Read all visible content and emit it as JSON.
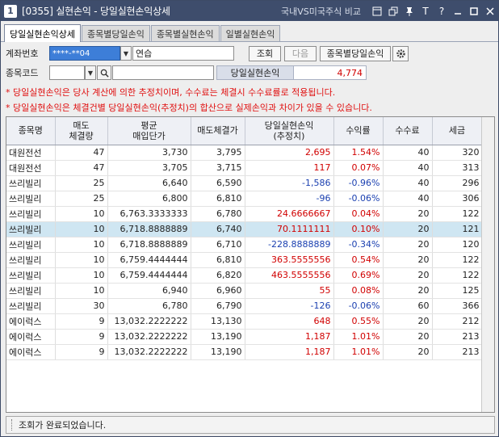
{
  "titlebar": {
    "badge": "1",
    "title": "[0355] 실현손익 - 당일실현손익상세",
    "compare_label": "국내VS미국주식 비교",
    "icons": [
      "window-icon",
      "restore-icon",
      "pin-icon",
      "font-size-icon",
      "help-icon",
      "minimize-icon",
      "maximize-icon",
      "close-icon"
    ],
    "font_icon_text": "T",
    "help_icon_text": "?"
  },
  "tabs": [
    "당일실현손익상세",
    "종목별당일손익",
    "종목별실현손익",
    "일별실현손익"
  ],
  "form": {
    "account_label": "계좌번호",
    "account_value": "****-**04",
    "account_name": "연습",
    "query_button": "조회",
    "next_button": "다음",
    "stock_daily_button": "종목별당일손익",
    "code_label": "종목코드",
    "pl_label": "당일실현손익",
    "pl_value": "4,774"
  },
  "notes": [
    "* 당일실현손익은 당사 계산에 의한 추정치이며, 수수료는 체결시 수수료률로 적용됩니다.",
    "* 당일실현손익은 체결건별 당일실현손익(추정치)의 합산으로 실제손익과 차이가 있을 수 있습니다."
  ],
  "table": {
    "headers": [
      [
        "종목명"
      ],
      [
        "매도",
        "체결량"
      ],
      [
        "평균",
        "매입단가"
      ],
      [
        "매도체결가"
      ],
      [
        "당일실현손익",
        "(추정치)"
      ],
      [
        "수익률"
      ],
      [
        "수수료"
      ],
      [
        "세금"
      ]
    ],
    "rows": [
      {
        "name": "대원전선",
        "qty": "47",
        "avg": "3,730",
        "sell": "3,795",
        "pl": "2,695",
        "rate": "1.54%",
        "fee": "40",
        "tax": "320",
        "sign": "pos"
      },
      {
        "name": "대원전선",
        "qty": "47",
        "avg": "3,705",
        "sell": "3,715",
        "pl": "117",
        "rate": "0.07%",
        "fee": "40",
        "tax": "313",
        "sign": "pos"
      },
      {
        "name": "쓰리빌리",
        "qty": "25",
        "avg": "6,640",
        "sell": "6,590",
        "pl": "-1,586",
        "rate": "-0.96%",
        "fee": "40",
        "tax": "296",
        "sign": "neg"
      },
      {
        "name": "쓰리빌리",
        "qty": "25",
        "avg": "6,800",
        "sell": "6,810",
        "pl": "-96",
        "rate": "-0.06%",
        "fee": "40",
        "tax": "306",
        "sign": "neg"
      },
      {
        "name": "쓰리빌리",
        "qty": "10",
        "avg": "6,763.3333333",
        "sell": "6,780",
        "pl": "24.6666667",
        "rate": "0.04%",
        "fee": "20",
        "tax": "122",
        "sign": "pos"
      },
      {
        "name": "쓰리빌리",
        "qty": "10",
        "avg": "6,718.8888889",
        "sell": "6,740",
        "pl": "70.1111111",
        "rate": "0.10%",
        "fee": "20",
        "tax": "121",
        "sign": "pos",
        "selected": true
      },
      {
        "name": "쓰리빌리",
        "qty": "10",
        "avg": "6,718.8888889",
        "sell": "6,710",
        "pl": "-228.8888889",
        "rate": "-0.34%",
        "fee": "20",
        "tax": "120",
        "sign": "neg"
      },
      {
        "name": "쓰리빌리",
        "qty": "10",
        "avg": "6,759.4444444",
        "sell": "6,810",
        "pl": "363.5555556",
        "rate": "0.54%",
        "fee": "20",
        "tax": "122",
        "sign": "pos"
      },
      {
        "name": "쓰리빌리",
        "qty": "10",
        "avg": "6,759.4444444",
        "sell": "6,820",
        "pl": "463.5555556",
        "rate": "0.69%",
        "fee": "20",
        "tax": "122",
        "sign": "pos"
      },
      {
        "name": "쓰리빌리",
        "qty": "10",
        "avg": "6,940",
        "sell": "6,960",
        "pl": "55",
        "rate": "0.08%",
        "fee": "20",
        "tax": "125",
        "sign": "pos"
      },
      {
        "name": "쓰리빌리",
        "qty": "30",
        "avg": "6,780",
        "sell": "6,790",
        "pl": "-126",
        "rate": "-0.06%",
        "fee": "60",
        "tax": "366",
        "sign": "neg"
      },
      {
        "name": "에이럭스",
        "qty": "9",
        "avg": "13,032.2222222",
        "sell": "13,130",
        "pl": "648",
        "rate": "0.55%",
        "fee": "20",
        "tax": "212",
        "sign": "pos"
      },
      {
        "name": "에이럭스",
        "qty": "9",
        "avg": "13,032.2222222",
        "sell": "13,190",
        "pl": "1,187",
        "rate": "1.01%",
        "fee": "20",
        "tax": "213",
        "sign": "pos"
      },
      {
        "name": "에이럭스",
        "qty": "9",
        "avg": "13,032.2222222",
        "sell": "13,190",
        "pl": "1,187",
        "rate": "1.01%",
        "fee": "20",
        "tax": "213",
        "sign": "pos"
      }
    ]
  },
  "status": "조회가 완료되었습니다.",
  "colors": {
    "positive": "#d10000",
    "negative": "#1a3fb0",
    "selected_row": "#cfe6f2",
    "titlebar": "#3e4d6c"
  }
}
